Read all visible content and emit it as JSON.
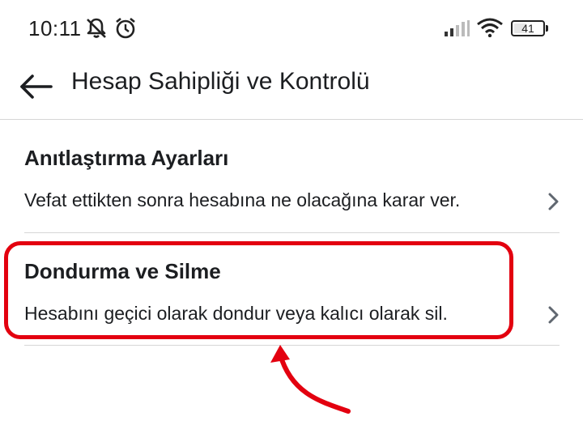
{
  "status_bar": {
    "time": "10:11",
    "battery": "41",
    "icons": [
      "bell-off-icon",
      "alarm-icon",
      "signal-icon",
      "wifi-icon",
      "battery-icon"
    ]
  },
  "header": {
    "title": "Hesap Sahipliği ve Kontrolü",
    "back_icon": "arrow-left-icon"
  },
  "items": [
    {
      "title": "Anıtlaştırma Ayarları",
      "description": "Vefat ettikten sonra hesabına ne olacağına karar ver.",
      "icon": "chevron-right-icon"
    },
    {
      "title": "Dondurma ve Silme",
      "description": "Hesabını geçici olarak dondur veya kalıcı olarak sil.",
      "icon": "chevron-right-icon"
    }
  ],
  "annotation": {
    "color": "#e3000f",
    "highlighted_item": "Dondurma ve Silme"
  },
  "colors": {
    "text": "#1c1e21",
    "divider": "#d6d6d6",
    "chevron": "#606770"
  }
}
